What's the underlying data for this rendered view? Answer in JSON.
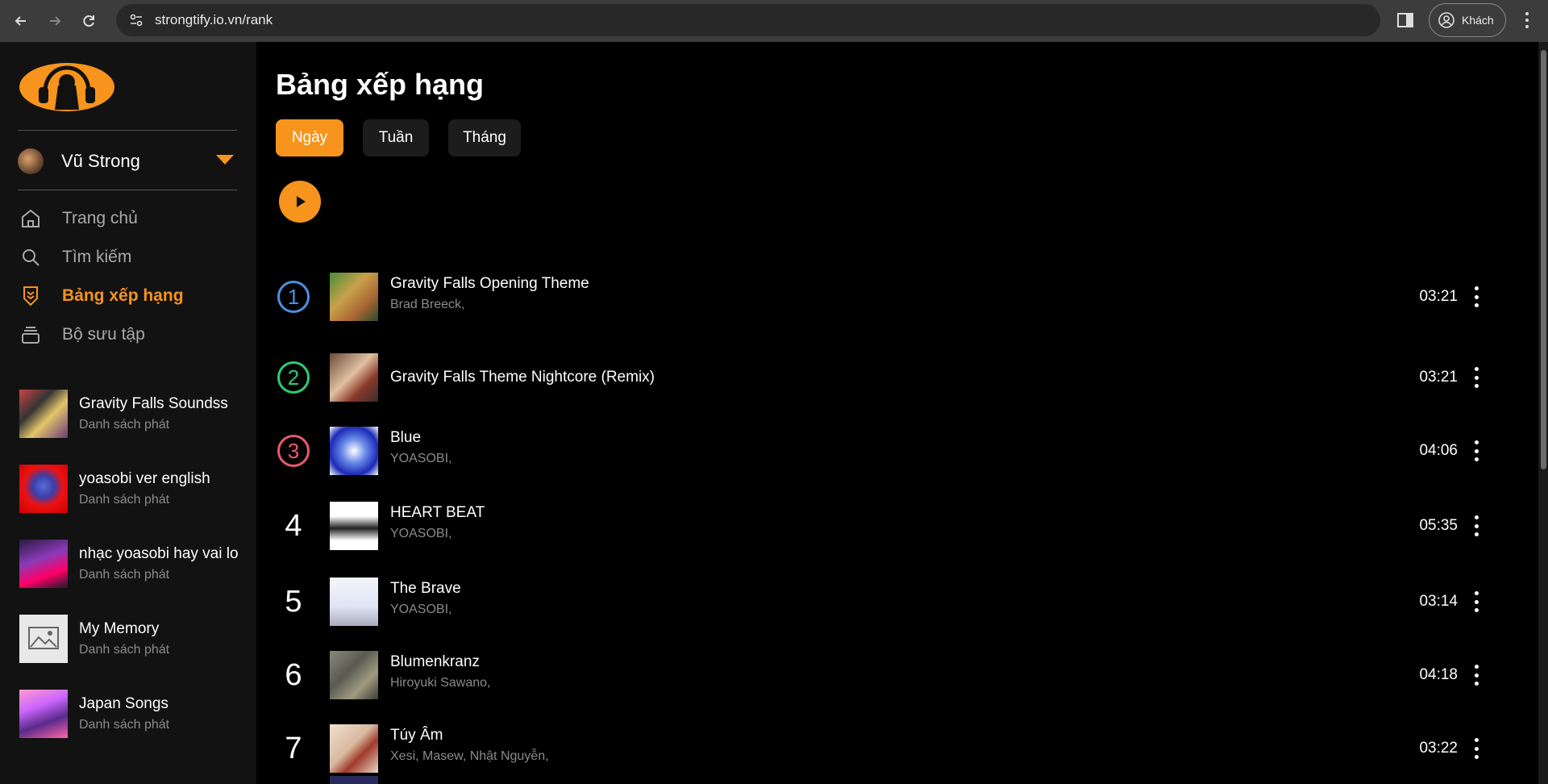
{
  "browser": {
    "url": "strongtify.io.vn/rank",
    "profile_label": "Khách"
  },
  "sidebar": {
    "user_name": "Vũ Strong",
    "nav": [
      {
        "label": "Trang chủ",
        "icon": "home-icon"
      },
      {
        "label": "Tìm kiếm",
        "icon": "search-icon"
      },
      {
        "label": "Bảng xếp hạng",
        "icon": "rank-badge-icon"
      },
      {
        "label": "Bộ sưu tập",
        "icon": "library-icon"
      }
    ],
    "playlists": [
      {
        "title": "Gravity Falls Soundss",
        "subtitle": "Danh sách phát"
      },
      {
        "title": "yoasobi ver english",
        "subtitle": "Danh sách phát"
      },
      {
        "title": "nhạc yoasobi hay vai lo",
        "subtitle": "Danh sách phát"
      },
      {
        "title": "My Memory",
        "subtitle": "Danh sách phát"
      },
      {
        "title": "Japan Songs",
        "subtitle": "Danh sách phát"
      }
    ]
  },
  "main": {
    "title": "Bảng xếp hạng",
    "tabs": [
      "Ngày",
      "Tuần",
      "Tháng"
    ],
    "active_tab": "Ngày",
    "songs": [
      {
        "rank": "1",
        "title": "Gravity Falls Opening Theme",
        "artist": "Brad Breeck,",
        "duration": "03:21"
      },
      {
        "rank": "2",
        "title": "Gravity Falls Theme Nightcore (Remix)",
        "artist": "",
        "duration": "03:21"
      },
      {
        "rank": "3",
        "title": "Blue",
        "artist": "YOASOBI,",
        "duration": "04:06"
      },
      {
        "rank": "4",
        "title": "HEART BEAT",
        "artist": "YOASOBI,",
        "duration": "05:35"
      },
      {
        "rank": "5",
        "title": "The Brave",
        "artist": "YOASOBI,",
        "duration": "03:14"
      },
      {
        "rank": "6",
        "title": "Blumenkranz",
        "artist": "Hiroyuki Sawano,",
        "duration": "04:18"
      },
      {
        "rank": "7",
        "title": "Túy Âm",
        "artist": "Xesi, Masew, Nhật Nguyễn,",
        "duration": "03:22"
      }
    ]
  },
  "colors": {
    "accent": "#f7941d",
    "rank1": "#4a90e2",
    "rank2": "#2ecc71",
    "rank3": "#e85a6a"
  }
}
